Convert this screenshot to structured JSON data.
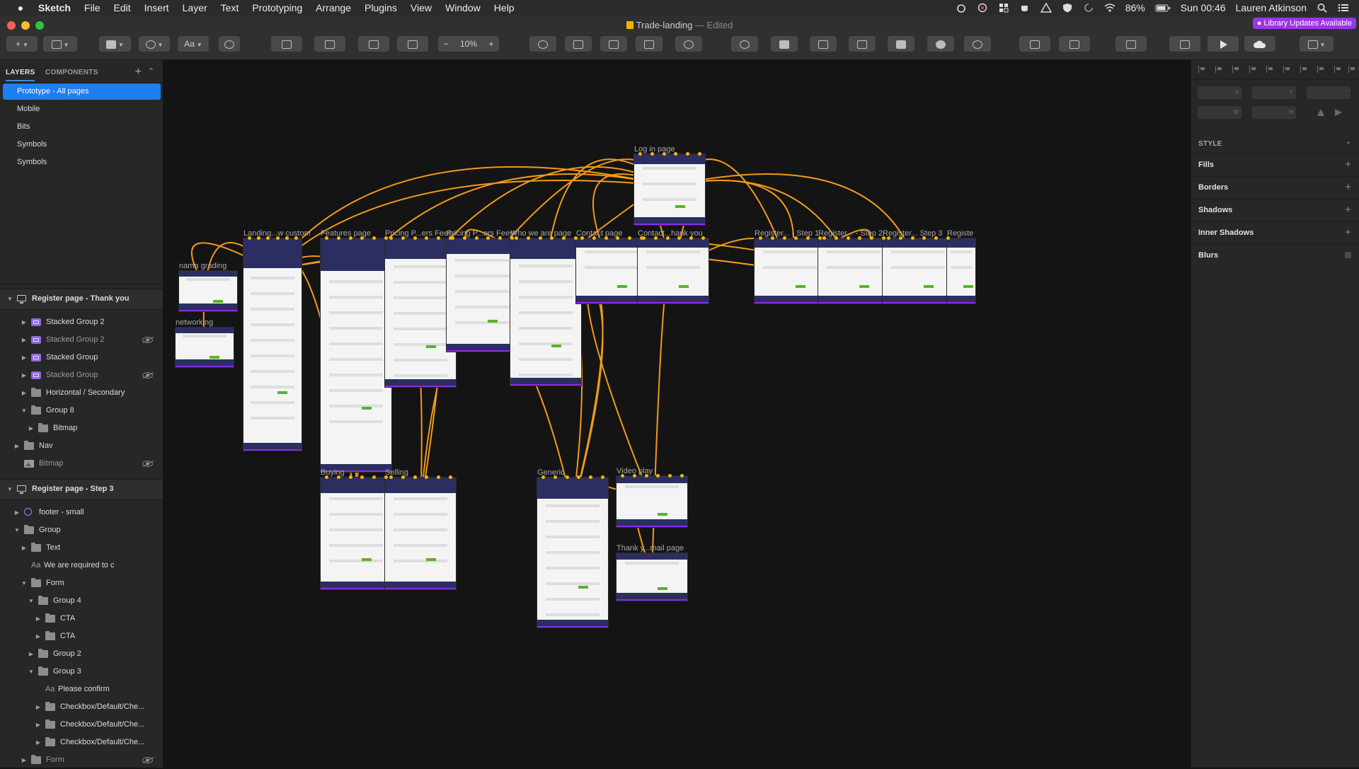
{
  "menubar": {
    "apple": "",
    "app_name": "Sketch",
    "menus": [
      "File",
      "Edit",
      "Insert",
      "Layer",
      "Text",
      "Prototyping",
      "Arrange",
      "Plugins",
      "View",
      "Window",
      "Help"
    ],
    "battery": "86%",
    "clock": "Sun 00:46",
    "user": "Lauren Atkinson"
  },
  "window": {
    "document_title": "Trade-landing",
    "edited_suffix": "— Edited",
    "library_badge": "Library Updates Available"
  },
  "toolbar": {
    "insert_symbol": "+",
    "text_style_label": "Aa",
    "zoom_minus": "−",
    "zoom_level": "10%",
    "zoom_plus": "+"
  },
  "sidebar": {
    "tabs": {
      "layers": "LAYERS",
      "components": "COMPONENTS"
    },
    "add_button": "+",
    "pages": [
      {
        "label": "Prototype - All pages",
        "selected": true
      },
      {
        "label": "Mobile"
      },
      {
        "label": "Bits"
      },
      {
        "label": "Symbols"
      },
      {
        "label": "Symbols"
      }
    ],
    "layers": [
      {
        "label": "Register page - Thank you",
        "type": "artboard",
        "expanded": true
      },
      {
        "label": "Stacked Group 2",
        "type": "stack",
        "hidden": false
      },
      {
        "label": "Stacked Group 2",
        "type": "stack",
        "hidden": true
      },
      {
        "label": "Stacked Group",
        "type": "stack",
        "hidden": false
      },
      {
        "label": "Stacked Group",
        "type": "stack",
        "hidden": true
      },
      {
        "label": "Horizontal / Secondary",
        "type": "folder"
      },
      {
        "label": "Group 8",
        "type": "folder",
        "expanded": true
      },
      {
        "label": "Bitmap",
        "type": "folder"
      },
      {
        "label": "Nav",
        "type": "folder"
      },
      {
        "label": "Bitmap",
        "type": "image",
        "hidden": true
      },
      {
        "label": "Register page - Step 3",
        "type": "artboard",
        "expanded": true
      },
      {
        "label": "footer - small",
        "type": "symbol"
      },
      {
        "label": "Group",
        "type": "folder",
        "expanded": true
      },
      {
        "label": "Text",
        "type": "folder"
      },
      {
        "label": "We are required to c",
        "type": "text"
      },
      {
        "label": "Form",
        "type": "folder",
        "expanded": true
      },
      {
        "label": "Group 4",
        "type": "folder",
        "expanded": true
      },
      {
        "label": "CTA",
        "type": "folder"
      },
      {
        "label": "CTA",
        "type": "folder"
      },
      {
        "label": "Group 2",
        "type": "folder"
      },
      {
        "label": "Group 3",
        "type": "folder",
        "expanded": true
      },
      {
        "label": "Please confirm",
        "type": "text"
      },
      {
        "label": "Checkbox/Default/Che...",
        "type": "folder"
      },
      {
        "label": "Checkbox/Default/Che...",
        "type": "folder"
      },
      {
        "label": "Checkbox/Default/Che...",
        "type": "folder"
      },
      {
        "label": "Form",
        "type": "folder",
        "hidden": true
      }
    ]
  },
  "canvas": {
    "artboards": [
      {
        "label": "Log in page"
      },
      {
        "label": "nama grading"
      },
      {
        "label": "networking"
      },
      {
        "label": "Landing...w custom"
      },
      {
        "label": "Features page"
      },
      {
        "label": "Pricing P...ers Fees"
      },
      {
        "label": "Pricing P...ers Fees"
      },
      {
        "label": "Who we are page"
      },
      {
        "label": "Contact page"
      },
      {
        "label": "Contact...hank you"
      },
      {
        "label": "Register... - Step 1"
      },
      {
        "label": "Register... - Step 2"
      },
      {
        "label": "Register... Step 3"
      },
      {
        "label": "Registe"
      },
      {
        "label": "Buying"
      },
      {
        "label": "Selling"
      },
      {
        "label": "Generic"
      },
      {
        "label": "Video play"
      },
      {
        "label": "Thank y...mail page"
      }
    ],
    "link_color": "#f29a18"
  },
  "inspector": {
    "fields": [
      "X",
      "Y",
      "°",
      "W",
      "H"
    ],
    "style_header": "STYLE",
    "sections": [
      "Fills",
      "Borders",
      "Shadows",
      "Inner Shadows",
      "Blurs"
    ]
  },
  "colors": {
    "selection": "#1f7ef0",
    "artboard_header": "#2c2e62",
    "cta_green": "#58b22f",
    "prototype_link": "#f29a18",
    "library_badge": "#9a35e8"
  }
}
